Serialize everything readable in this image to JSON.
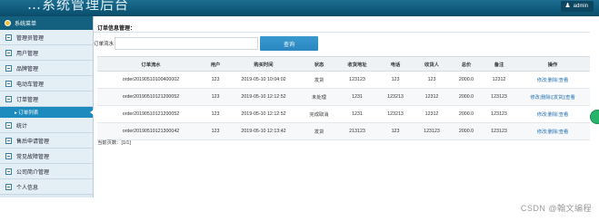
{
  "header": {
    "title": "…系统管理后台",
    "admin_label": "admin"
  },
  "sidebar": {
    "head": "系统菜单",
    "items": [
      {
        "label": "管理员管理"
      },
      {
        "label": "用户管理"
      },
      {
        "label": "品牌管理"
      },
      {
        "label": "电动车管理"
      },
      {
        "label": "订单管理"
      },
      {
        "label": "统计"
      },
      {
        "label": "售后申请管理"
      },
      {
        "label": "常见故障管理"
      },
      {
        "label": "公司简介管理"
      },
      {
        "label": "个人信息"
      }
    ],
    "active_sub": "▸ 订单列表"
  },
  "main": {
    "page_title": "订单信息管理：",
    "search": {
      "label": "订单流水",
      "value": "",
      "button": "查询"
    },
    "table": {
      "headers": [
        "订单流水",
        "用户",
        "购买时间",
        "状态",
        "收货地址",
        "电话",
        "收货人",
        "总价",
        "备注",
        "操作"
      ],
      "rows": [
        [
          "order20190510100400002",
          "123",
          "2019-05-10 10:04:02",
          "发货",
          "123123",
          "123",
          "123",
          "2000.0",
          "12312"
        ],
        [
          "order20190510121200052",
          "123",
          "2019-05-10 12:12:52",
          "未处理",
          "1231",
          "123213",
          "12312",
          "2000.0",
          "123123"
        ],
        [
          "order20190510121200052",
          "123",
          "2019-05-10 12:12:52",
          "完成取消",
          "1231",
          "123213",
          "12312",
          "2000.0",
          "123123"
        ],
        [
          "order20190510121300042",
          "123",
          "2019-05-10 12:13:42",
          "发货",
          "213123",
          "123",
          "123123",
          "2000.0",
          "123123"
        ]
      ],
      "ops": [
        [
          "修改",
          "删除",
          "查看"
        ],
        [
          "修改",
          "删除",
          "[发货]",
          "查看"
        ],
        [
          "修改",
          "删除",
          "查看"
        ],
        [
          "修改",
          "删除",
          "查看"
        ]
      ]
    },
    "pager": "当前页数：[1/1]"
  },
  "watermark": "CSDN @翰文编程",
  "colors": {
    "banner": "#0f5a7b",
    "sidebar_bg": "#dde9f1",
    "active_sub": "#1d8bbd",
    "button": "#2a86bf",
    "link": "#1f6fb2"
  }
}
